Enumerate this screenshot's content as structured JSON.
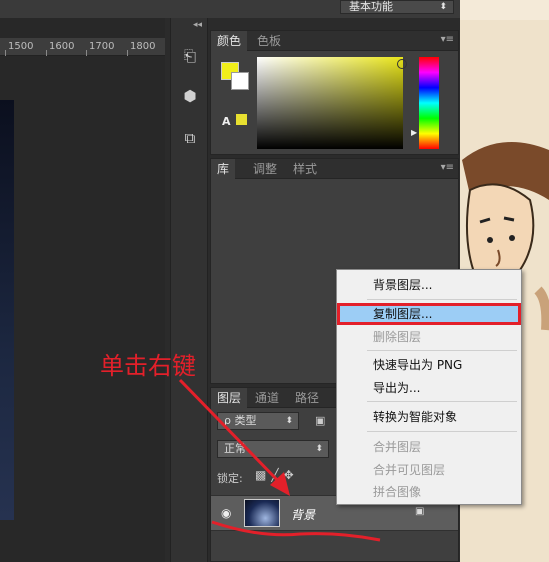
{
  "workspace": {
    "label": "基本功能"
  },
  "ruler": {
    "ticks": [
      "1500",
      "1600",
      "1700",
      "1800"
    ]
  },
  "color_panel": {
    "tabs": [
      "颜色",
      "色板"
    ],
    "foreground": "#f1ee1a",
    "background": "#ffffff"
  },
  "library_panel": {
    "tabs": [
      "库",
      "调整",
      "样式"
    ]
  },
  "layers_panel": {
    "tabs": [
      "图层",
      "通道",
      "路径"
    ],
    "filter_label": "ρ 类型",
    "blend_mode": "正常",
    "lock_label": "锁定:",
    "layer": {
      "name": "背景"
    }
  },
  "context_menu": {
    "items": [
      {
        "label": "背景图层...",
        "enabled": true
      },
      {
        "label": "复制图层...",
        "enabled": true,
        "highlighted": true
      },
      {
        "label": "删除图层",
        "enabled": false
      },
      {
        "label": "快速导出为 PNG",
        "enabled": true
      },
      {
        "label": "导出为...",
        "enabled": true
      },
      {
        "label": "转换为智能对象",
        "enabled": true
      },
      {
        "label": "合并图层",
        "enabled": false
      },
      {
        "label": "合并可见图层",
        "enabled": false
      },
      {
        "label": "拼合图像",
        "enabled": false
      }
    ]
  },
  "annotation": {
    "text": "单击右键",
    "color": "#e3202a"
  },
  "icons": [
    "collapse-icon",
    "history-icon",
    "3d-icon",
    "properties-icon",
    "panel-menu-icon",
    "eye-icon",
    "lock-icon"
  ]
}
